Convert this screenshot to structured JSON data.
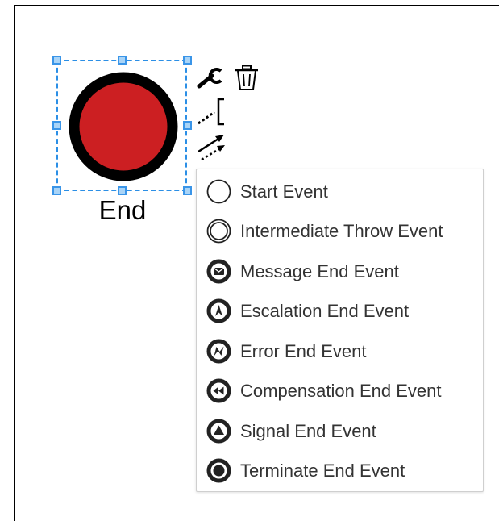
{
  "element": {
    "label": "End",
    "fill_color": "#cc1f22",
    "border_color": "#000000"
  },
  "selection": {
    "color": "#2b8fe6"
  },
  "context_pad": [
    {
      "name": "wrench-icon",
      "title": "change type"
    },
    {
      "name": "trash-icon",
      "title": "remove"
    },
    {
      "name": "text-annotation-icon",
      "title": "text annotation"
    },
    {
      "name": "connect-arrow-icon",
      "title": "connect"
    }
  ],
  "replace_menu": {
    "items": [
      {
        "label": "Start Event",
        "icon": "start-event-icon"
      },
      {
        "label": "Intermediate Throw Event",
        "icon": "intermediate-throw-event-icon"
      },
      {
        "label": "Message End Event",
        "icon": "message-end-event-icon"
      },
      {
        "label": "Escalation End Event",
        "icon": "escalation-end-event-icon"
      },
      {
        "label": "Error End Event",
        "icon": "error-end-event-icon"
      },
      {
        "label": "Compensation End Event",
        "icon": "compensation-end-event-icon"
      },
      {
        "label": "Signal End Event",
        "icon": "signal-end-event-icon"
      },
      {
        "label": "Terminate End Event",
        "icon": "terminate-end-event-icon"
      }
    ]
  }
}
